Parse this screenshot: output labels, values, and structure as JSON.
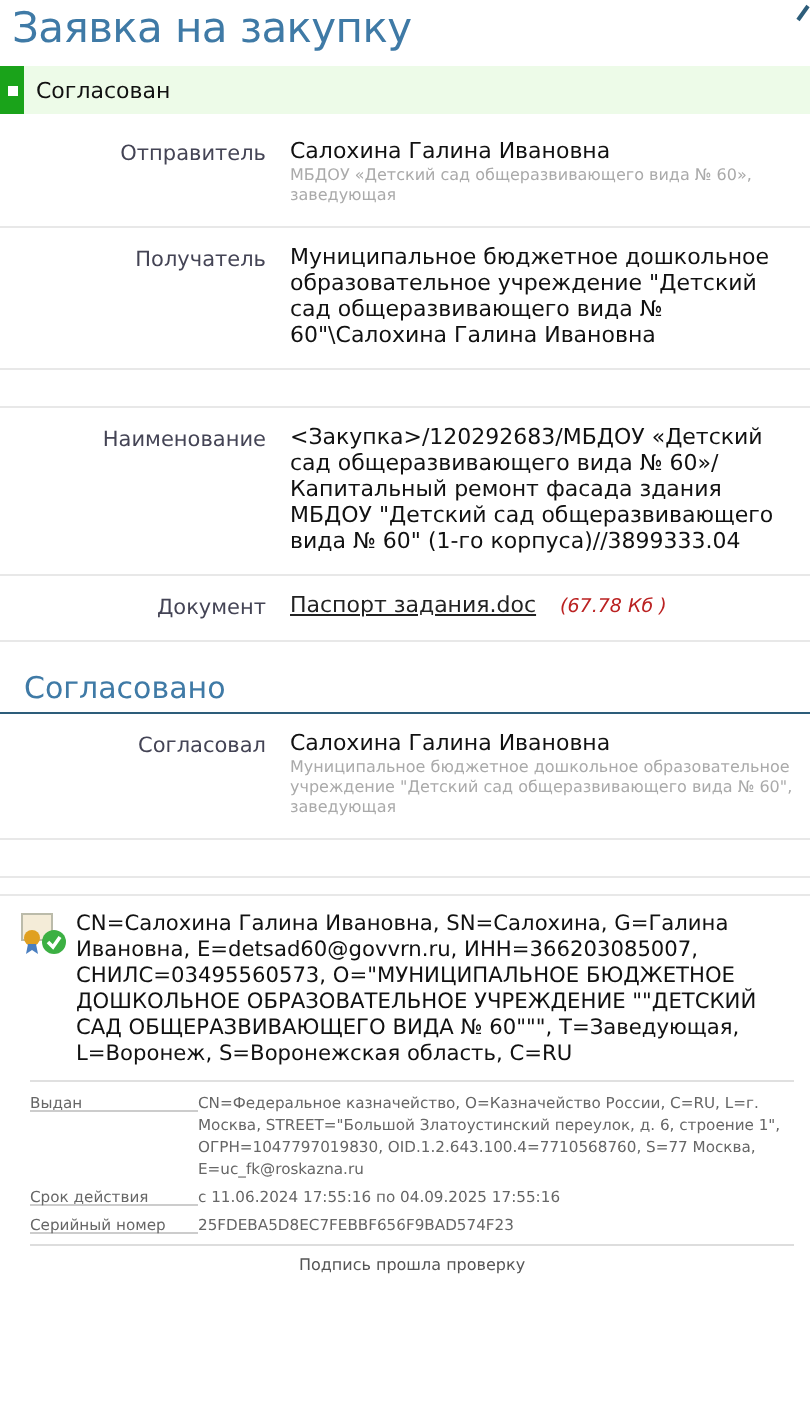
{
  "title": "Заявка на закупку",
  "status": {
    "label": "Согласован",
    "color": "#1aa31a"
  },
  "fields": [
    {
      "kind": "person",
      "label": "Отправитель",
      "name": "Салохина Галина Ивановна",
      "note": "МБДОУ «Детский сад общеразвивающего вида № 60», заведующая"
    },
    {
      "kind": "text",
      "label": "Получатель",
      "value": "Муниципальное бюджетное дошкольное образовательное учреждение \"Детский сад общеразвивающего вида № 60\"\\Салохина Галина Ивановна"
    },
    {
      "kind": "empty"
    },
    {
      "kind": "text",
      "label": "Наименование",
      "value": "<Закупка>/120292683/МБДОУ «Детский сад общеразвивающего вида № 60»/ Капитальный ремонт фасада здания МБДОУ \"Детский сад общеразвивающего вида № 60\" (1-го корпуса)//3899333.04"
    },
    {
      "kind": "document",
      "label": "Документ",
      "link": "Паспорт задания.doc",
      "size": "(67.78 Кб )"
    }
  ],
  "approval": {
    "heading": "Согласовано",
    "label": "Согласовал",
    "name": "Салохина Галина Ивановна",
    "note": "Муниципальное бюджетное дошкольное образовательное учреждение \"Детский сад общеразвивающего вида № 60\", заведующая"
  },
  "certificate": {
    "subject": "CN=Салохина Галина Ивановна, SN=Салохина, G=Галина Ивановна, E=detsad60@govvrn.ru, ИНН=366203085007, СНИЛС=03495560573, O=\"МУНИЦИПАЛЬНОЕ БЮДЖЕТНОЕ ДОШКОЛЬНОЕ ОБРАЗОВАТЕЛЬНОЕ УЧРЕЖДЕНИЕ \"\"ДЕТСКИЙ САД ОБЩЕРАЗВИВАЮЩЕГО ВИДА № 60\"\"\", T=Заведующая, L=Воронеж, S=Воронежская область, C=RU",
    "details": [
      {
        "label": "Выдан",
        "value": "CN=Федеральное казначейство, O=Казначейство России, C=RU, L=г. Москва, STREET=\"Большой Златоустинский переулок, д. 6, строение 1\", ОГРН=1047797019830, OID.1.2.643.100.4=7710568760, S=77 Москва, E=uc_fk@roskazna.ru"
      },
      {
        "label": "Срок действия",
        "value": "с 11.06.2024 17:55:16 по 04.09.2025 17:55:16"
      },
      {
        "label": "Серийный номер",
        "value": "25FDEBA5D8EC7FEBBF656F9BAD574F23"
      }
    ],
    "verdict": "Подпись прошла проверку"
  }
}
